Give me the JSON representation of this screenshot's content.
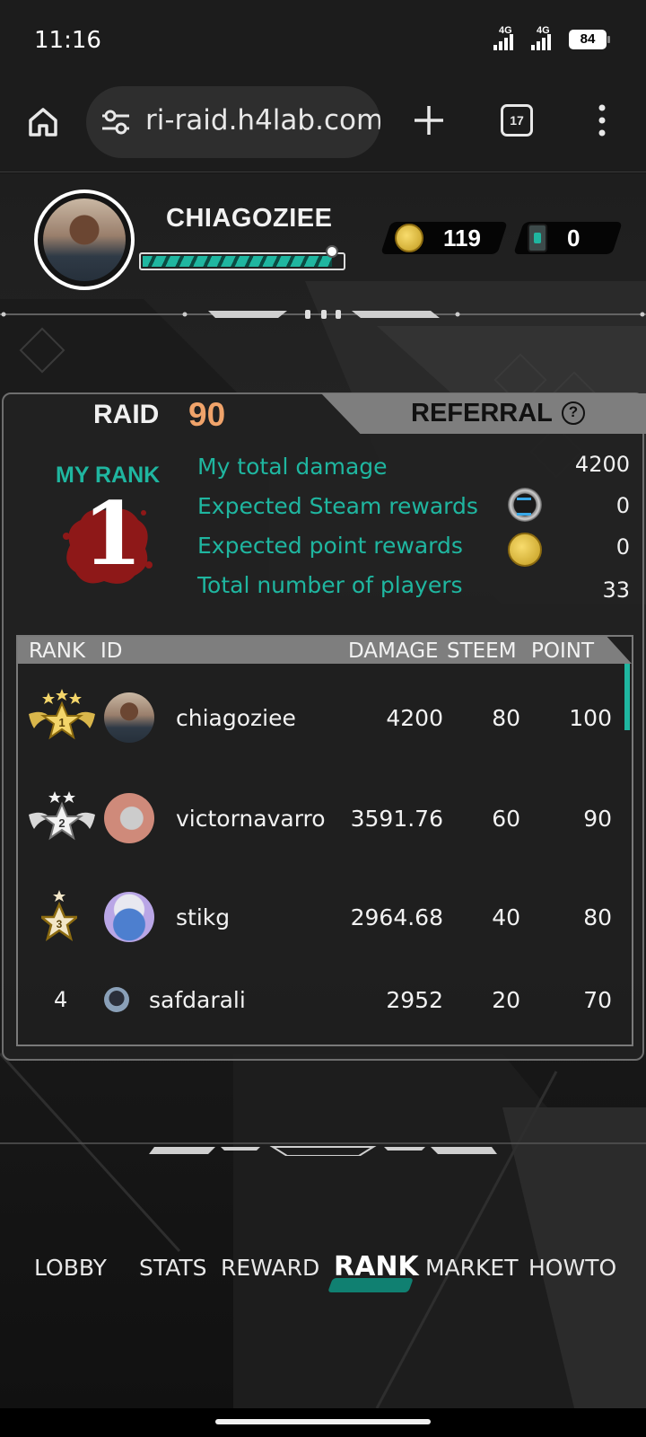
{
  "status_bar": {
    "time": "11:16",
    "network_1": "4G",
    "network_2": "4G",
    "battery": "84"
  },
  "browser": {
    "url": "ri-raid.h4lab.com",
    "tab_count": "17"
  },
  "profile": {
    "username": "CHIAGOZIEE",
    "xp_fraction": 0.95,
    "coins": "119",
    "tickets": "0"
  },
  "tabs": {
    "raid_label": "RAID",
    "raid_number": "90",
    "referral_label": "REFERRAL",
    "help_symbol": "?"
  },
  "my_rank": {
    "label": "MY RANK",
    "rank": "1",
    "stats": [
      {
        "label": "My total damage",
        "value": "4200"
      },
      {
        "label": "Expected Steam rewards",
        "value": "0",
        "icon": "steem-icon"
      },
      {
        "label": "Expected point rewards",
        "value": "0",
        "icon": "point-coin-icon"
      },
      {
        "label": "Total number of players",
        "value": "33"
      }
    ]
  },
  "leaderboard": {
    "headers": {
      "rank": "RANK",
      "id": "ID",
      "damage": "DAMAGE",
      "steem": "STEEM",
      "point": "POINT"
    },
    "rows": [
      {
        "rank": "1",
        "id": "chiagoziee",
        "damage": "4200",
        "steem": "80",
        "point": "100",
        "badge": "gold-wing-badge-icon"
      },
      {
        "rank": "2",
        "id": "victornavarro",
        "damage": "3591.76",
        "steem": "60",
        "point": "90",
        "badge": "silver-wing-badge-icon"
      },
      {
        "rank": "3",
        "id": "stikg",
        "damage": "2964.68",
        "steem": "40",
        "point": "80",
        "badge": "bronze-star-badge-icon"
      },
      {
        "rank": "4",
        "id": "safdarali",
        "damage": "2952",
        "steem": "20",
        "point": "70"
      }
    ]
  },
  "nav": {
    "items": [
      "LOBBY",
      "STATS",
      "REWARD",
      "RANK",
      "MARKET",
      "HOWTO"
    ],
    "active": "RANK"
  },
  "colors": {
    "accent": "#1fb6a0",
    "raid_number": "#f0a36a",
    "panel_border": "#6e6e6e"
  }
}
